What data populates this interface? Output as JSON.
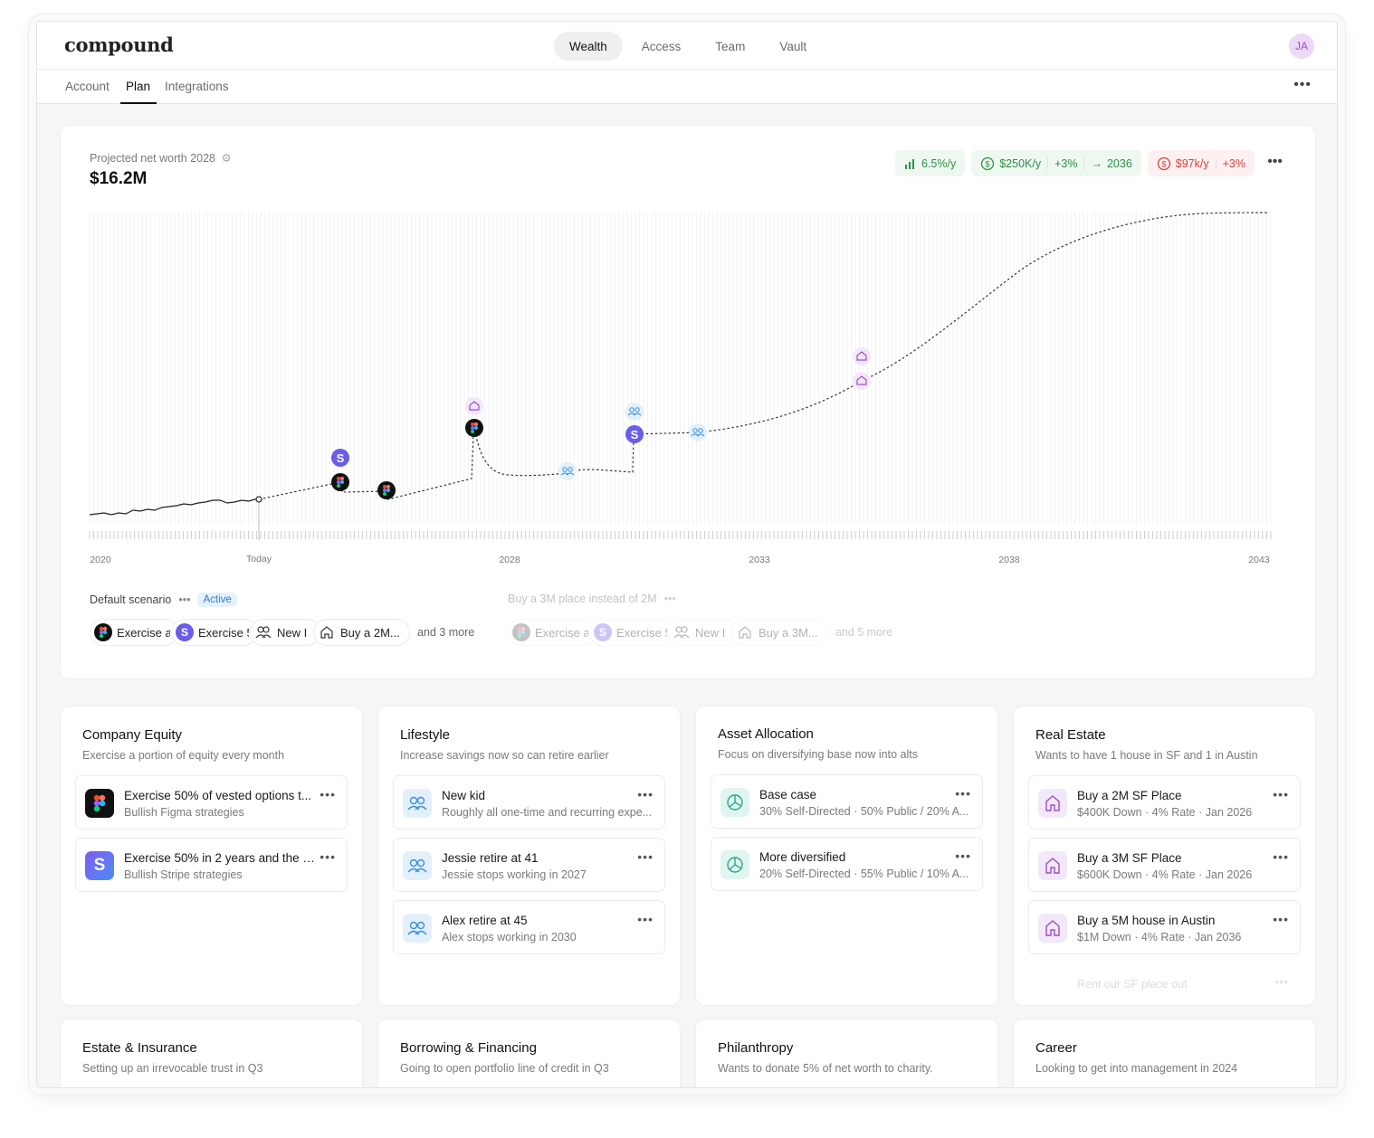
{
  "app": {
    "logo": "compound"
  },
  "nav": {
    "main": [
      "Wealth",
      "Access",
      "Team",
      "Vault"
    ],
    "active": "Wealth",
    "avatar_initials": "JA"
  },
  "subnav": {
    "tabs": [
      "Account",
      "Plan",
      "Integrations"
    ],
    "active": "Plan"
  },
  "projection": {
    "label": "Projected net worth 2028",
    "value": "$16.2M",
    "pills": {
      "growth": "6.5%/y",
      "income": "$250K/y",
      "income_growth": "+3%",
      "income_until": "2036",
      "spend": "$97k/y",
      "spend_growth": "+3%"
    },
    "x_axis_labels": [
      "2020",
      "Today",
      "2028",
      "2033",
      "2038",
      "2043"
    ]
  },
  "scenarios": {
    "default": {
      "name": "Default scenario",
      "badge": "Active",
      "chips": [
        "Exercise a",
        "Exercise 5",
        "New I",
        "Buy a 2M..."
      ],
      "more": "and 3 more"
    },
    "alt": {
      "name": "Buy a 3M place instead of 2M",
      "chips": [
        "Exercise a",
        "Exercise 5",
        "New I",
        "Buy a 3M..."
      ],
      "more": "and 5 more"
    }
  },
  "cards": {
    "company_equity": {
      "title": "Company Equity",
      "subtitle": "Exercise a portion of equity every month",
      "items": [
        {
          "title": "Exercise 50% of vested options t...",
          "sub": "Bullish Figma strategies",
          "icon": "figma-icon"
        },
        {
          "title": "Exercise 50% in 2 years and the r...",
          "sub": "Bullish Stripe strategies",
          "icon": "stripe-icon"
        }
      ]
    },
    "lifestyle": {
      "title": "Lifestyle",
      "subtitle": "Increase savings now so can retire earlier",
      "items": [
        {
          "title": "New kid",
          "sub": "Roughly all one-time and recurring expe...",
          "icon": "people-icon"
        },
        {
          "title": "Jessie retire at 41",
          "sub": "Jessie stops working in 2027",
          "icon": "people-icon"
        },
        {
          "title": "Alex retire at 45",
          "sub": "Alex stops working in 2030",
          "icon": "people-icon"
        }
      ]
    },
    "asset_allocation": {
      "title": "Asset Allocation",
      "subtitle": "Focus on diversifying base now into alts",
      "items": [
        {
          "title": "Base case",
          "sub": "30% Self-Directed · 50% Public / 20% A...",
          "icon": "pie-icon"
        },
        {
          "title": "More diversified",
          "sub": "20% Self-Directed · 55% Public / 10% A...",
          "icon": "pie-icon"
        }
      ]
    },
    "real_estate": {
      "title": "Real Estate",
      "subtitle": "Wants to have 1 house in SF and 1 in Austin",
      "items": [
        {
          "title": "Buy a 2M SF Place",
          "sub": "$400K Down · 4% Rate · Jan 2026",
          "icon": "house-icon"
        },
        {
          "title": "Buy a 3M SF Place",
          "sub": "$600K Down · 4% Rate · Jan 2026",
          "icon": "house-icon"
        },
        {
          "title": "Buy a 5M house in Austin",
          "sub": "$1M Down · 4% Rate · Jan 2036",
          "icon": "house-icon"
        }
      ],
      "faded_item": "Rent our SF place out"
    },
    "estate": {
      "title": "Estate & Insurance",
      "subtitle": "Setting up an irrevocable trust in Q3"
    },
    "borrowing": {
      "title": "Borrowing & Financing",
      "subtitle": "Going to open portfolio line of credit in Q3"
    },
    "philanthropy": {
      "title": "Philanthropy",
      "subtitle": "Wants to donate 5% of net worth to charity."
    },
    "career": {
      "title": "Career",
      "subtitle": "Looking to get into management in 2024"
    }
  }
}
